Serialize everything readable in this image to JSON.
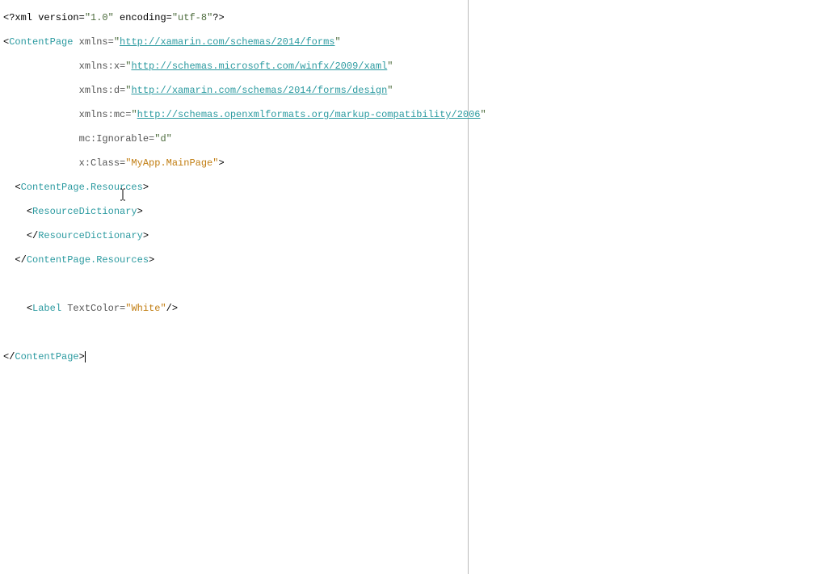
{
  "code": {
    "xml_decl_prefix": "<?xml version=",
    "xml_version": "\"1.0\"",
    "xml_enc_attr": " encoding=",
    "xml_enc": "\"utf-8\"",
    "xml_decl_suffix": "?>",
    "tag_open": "<",
    "tag_open_close": "</",
    "tag_close": ">",
    "tag_self_close": "/>",
    "ContentPage": "ContentPage",
    "ContentPage_Resources": "ContentPage.Resources",
    "ResourceDictionary": "ResourceDictionary",
    "Label": "Label",
    "attr_xmlns": "xmlns=",
    "attr_xmlns_x": "xmlns:x=",
    "attr_xmlns_d": "xmlns:d=",
    "attr_xmlns_mc": "xmlns:mc=",
    "attr_mc_Ignorable": "mc:Ignorable=",
    "attr_x_Class": "x:Class=",
    "attr_TextColor": " TextColor=",
    "q": "\"",
    "url1": "http://xamarin.com/schemas/2014/forms",
    "url2": "http://schemas.microsoft.com/winfx/2009/xaml",
    "url3": "http://xamarin.com/schemas/2014/forms/design",
    "url4": "http://schemas.openxmlformats.org/markup-compatibility/2006",
    "val_d": "\"d\"",
    "val_class": "\"MyApp.MainPage\"",
    "val_white": "\"White\""
  }
}
